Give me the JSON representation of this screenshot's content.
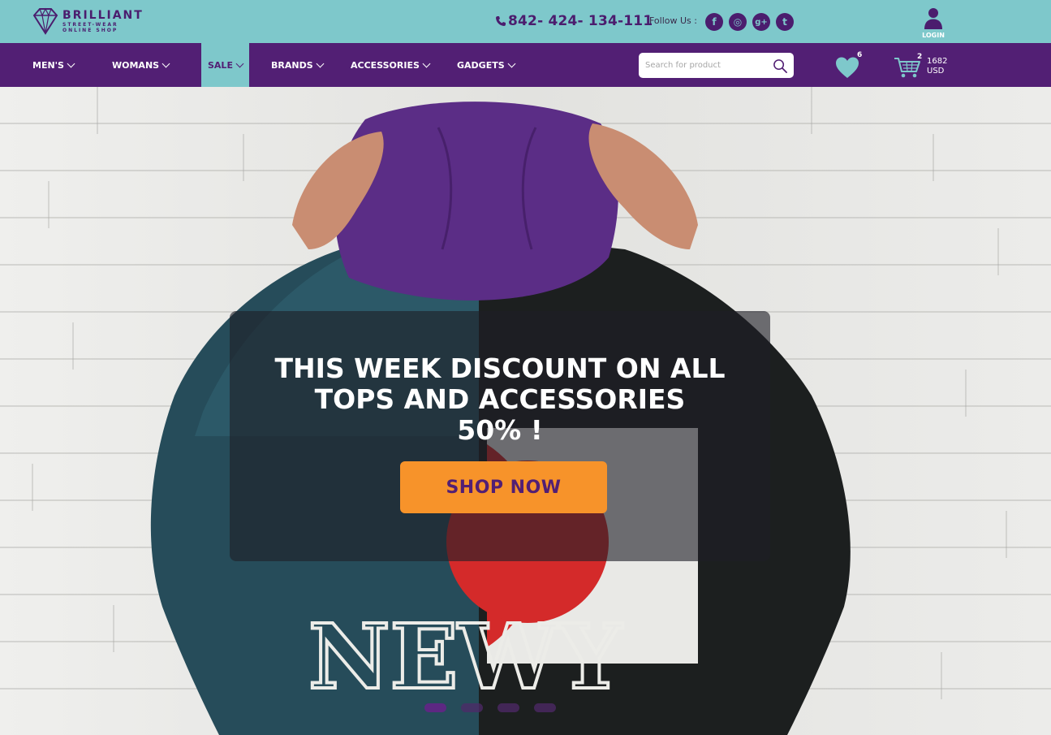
{
  "brand": {
    "name": "BRILLIANT",
    "tagline_line1": "STREET-WEAR",
    "tagline_line2": "ONLINE SHOP",
    "logo_icon": "diamond-icon"
  },
  "contact": {
    "phone": "842- 424- 134-111",
    "phone_icon": "phone-icon"
  },
  "social": {
    "label": "Follow Us :",
    "networks": [
      {
        "name": "facebook",
        "icon": "facebook-icon",
        "glyph": "f"
      },
      {
        "name": "instagram",
        "icon": "instagram-icon",
        "glyph": "◎"
      },
      {
        "name": "google-plus",
        "icon": "google-plus-icon",
        "glyph": "g+"
      },
      {
        "name": "twitter",
        "icon": "twitter-icon",
        "glyph": "t"
      }
    ]
  },
  "account": {
    "login_label": "LOGIN",
    "login_icon": "user-icon"
  },
  "nav": {
    "items": [
      {
        "label": "MEN'S",
        "active": false
      },
      {
        "label": "WOMANS",
        "active": false
      },
      {
        "label": "SALE",
        "active": true
      },
      {
        "label": "BRANDS",
        "active": false
      },
      {
        "label": "ACCESSORIES",
        "active": false
      },
      {
        "label": "GADGETS",
        "active": false
      }
    ]
  },
  "search": {
    "placeholder": "Search for product",
    "value": "",
    "icon": "search-icon"
  },
  "wishlist": {
    "count": "6",
    "icon": "heart-icon"
  },
  "cart": {
    "count": "2",
    "total_amount": "1682",
    "currency": "USD",
    "icon": "cart-icon"
  },
  "hero": {
    "title_line1": "THIS WEEK DISCOUNT ON ALL",
    "title_line2": "TOPS AND ACCESSORIES",
    "title_line3": "50% !",
    "cta_label": "SHOP NOW",
    "slides_total": 4,
    "active_slide": 1
  },
  "colors": {
    "topbar": "#7ec8cb",
    "navbar": "#521f74",
    "accent": "#f7932a",
    "brand_purple": "#4b1d6e"
  }
}
